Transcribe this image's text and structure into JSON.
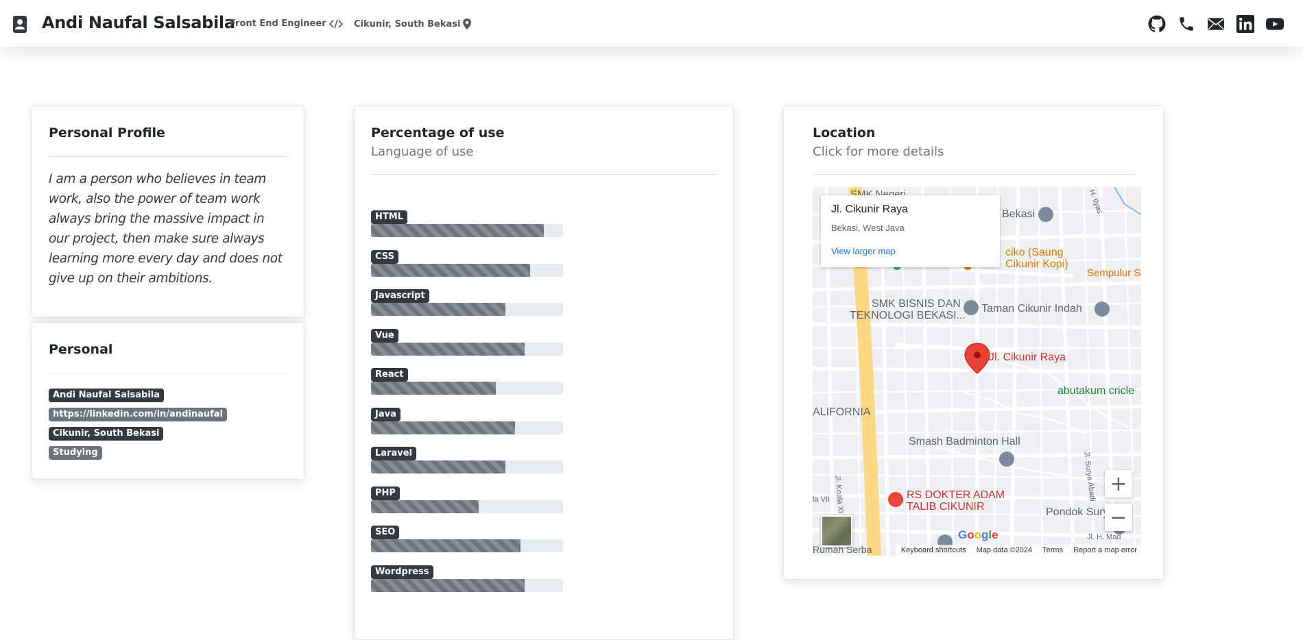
{
  "header": {
    "name": "Andi Naufal Salsabila",
    "role": "Front End Engineer",
    "location": "Cikunir, South Bekasi",
    "social_icons": [
      "github-icon",
      "phone-icon",
      "mail-icon",
      "linkedin-icon",
      "youtube-icon"
    ]
  },
  "profile": {
    "title": "Personal Profile",
    "text": "I am a person who believes in team work, also the power of team work always bring the massive impact in our project, then make sure always learning more every day and does not give up on their ambitions."
  },
  "personal": {
    "title": "Personal",
    "tags": [
      {
        "text": "Andi Naufal Salsabila",
        "style": "dark"
      },
      {
        "text": "https://linkedin.com/in/andinaufal",
        "style": "grey"
      },
      {
        "text": "Cikunir, South Bekasi",
        "style": "dark"
      },
      {
        "text": "Studying",
        "style": "grey"
      }
    ]
  },
  "usage": {
    "title": "Percentage of use",
    "subtitle": "Language of use",
    "skills": [
      {
        "name": "HTML",
        "percent": 90
      },
      {
        "name": "CSS",
        "percent": 83
      },
      {
        "name": "Javascript",
        "percent": 70
      },
      {
        "name": "Vue",
        "percent": 80
      },
      {
        "name": "React",
        "percent": 65
      },
      {
        "name": "Java",
        "percent": 75
      },
      {
        "name": "Laravel",
        "percent": 70
      },
      {
        "name": "PHP",
        "percent": 56
      },
      {
        "name": "SEO",
        "percent": 78
      },
      {
        "name": "Wordpress",
        "percent": 80
      }
    ]
  },
  "location": {
    "title": "Location",
    "subtitle": "Click for more details",
    "map": {
      "info_title": "Jl. Cikunir Raya",
      "info_address": "Bekasi, West Java",
      "info_link": "View larger map",
      "labels": {
        "smk_negeri": "SMK Negeri",
        "bekasi": "Bekasi",
        "saung_line1": "ciko (Saung",
        "saung_line2": "Cikunir Kopi)",
        "sempulur": "Sempulur S",
        "smk_bisnis_line1": "SMK BISNIS DAN",
        "smk_bisnis_line2": "TEKNOLOGI BEKASI...",
        "taman": "Taman Cikunir Indah",
        "pin_label": "Jl. Cikunir Raya",
        "abutakum": "abutakum cricle",
        "california": "ALIFORNIA",
        "badminton": "Smash Badminton Hall",
        "rs_line1": "RS DOKTER ADAM",
        "rs_line2": "TALIB CIKUNIR",
        "pondok": "Pondok Surya M",
        "koala": "Jl. Koala XI",
        "koala_vii": "la VII",
        "surya": "Jl. Surya Abadi",
        "ilyas": "H. Ilyas",
        "madi": "Jl. H. Mad",
        "serba": "Rumah Serba"
      },
      "zoom_in": "+",
      "zoom_out": "−",
      "google": [
        "G",
        "o",
        "o",
        "g",
        "l",
        "e"
      ],
      "footer": [
        "Keyboard shortcuts",
        "Map data ©2024",
        "Terms",
        "Report a map error"
      ]
    }
  },
  "colors": {
    "badge_dark": "#343a40",
    "badge_grey": "#6c757d",
    "bar_track": "#e9ecef",
    "map_pin": "#ea4335"
  }
}
